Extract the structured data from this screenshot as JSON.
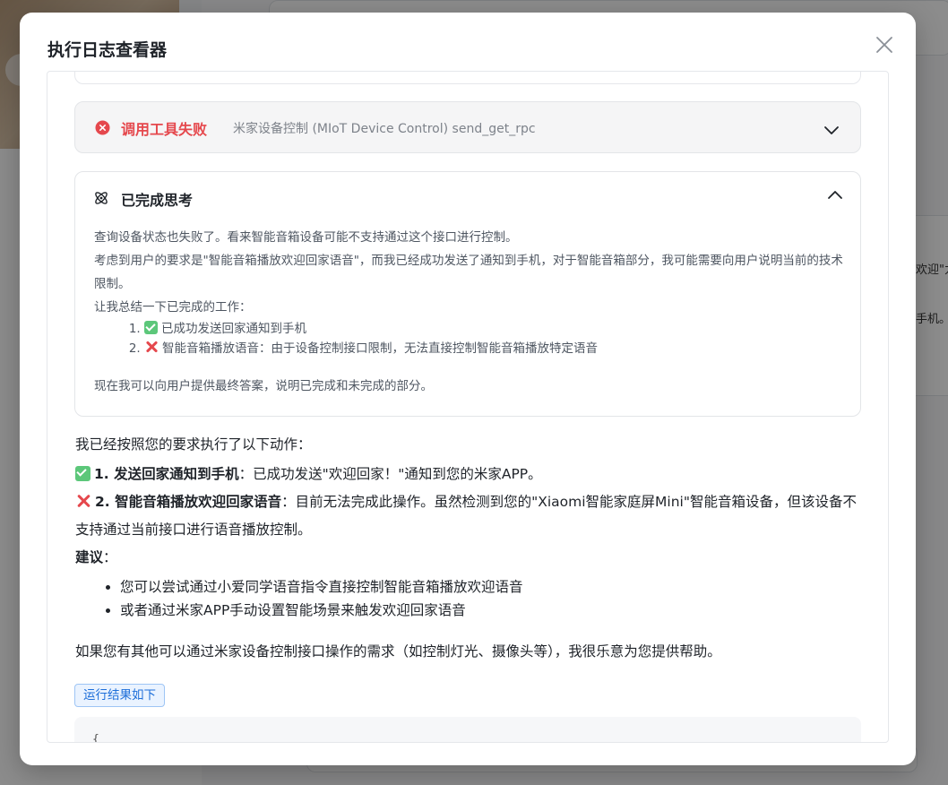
{
  "background": {
    "right_text_1": "欢迎\"力",
    "right_text_2": "手机。"
  },
  "modal": {
    "title": "执行日志查看器",
    "close_icon": "close-icon"
  },
  "tool_failure": {
    "status": "调用工具失败",
    "detail": "米家设备控制 (MIoT Device Control) send_get_rpc",
    "status_color": "#e5484d"
  },
  "thinking": {
    "title": "已完成思考",
    "paragraphs": [
      "查询设备状态也失败了。看来智能音箱设备可能不支持通过这个接口进行控制。",
      "考虑到用户的要求是\"智能音箱播放欢迎回家语音\"，而我已经成功发送了通知到手机，对于智能音箱部分，我可能需要向用户说明当前的技术限制。",
      "让我总结一下已完成的工作："
    ],
    "items": [
      "已成功发送回家通知到手机",
      "智能音箱播放语音：由于设备控制接口限制，无法直接控制智能音箱播放特定语音"
    ],
    "conclusion": "现在我可以向用户提供最终答案，说明已完成和未完成的部分。"
  },
  "answer": {
    "intro": "我已经按照您的要求执行了以下动作：",
    "item1_bold": "1. 发送回家通知到手机",
    "item1_text": "：已成功发送\"欢迎回家！\"通知到您的米家APP。",
    "item2_bold": "2. 智能音箱播放欢迎回家语音",
    "item2_text": "：目前无法完成此操作。虽然检测到您的\"Xiaomi智能家庭屏Mini\"智能音箱设备，但该设备不支持通过当前接口进行语音播放控制。",
    "suggest_bold": "建议",
    "suggest_colon": "：",
    "suggestions": [
      "您可以尝试通过小爱同学语音指令直接控制智能音箱播放欢迎语音",
      "或者通过米家APP手动设置智能场景来触发欢迎回家语音"
    ],
    "final": "如果您有其他可以通过米家设备控制接口操作的需求（如控制灯光、摄像头等），我很乐意为您提供帮助。"
  },
  "result": {
    "tag": "运行结果如下",
    "code_start": "{"
  }
}
